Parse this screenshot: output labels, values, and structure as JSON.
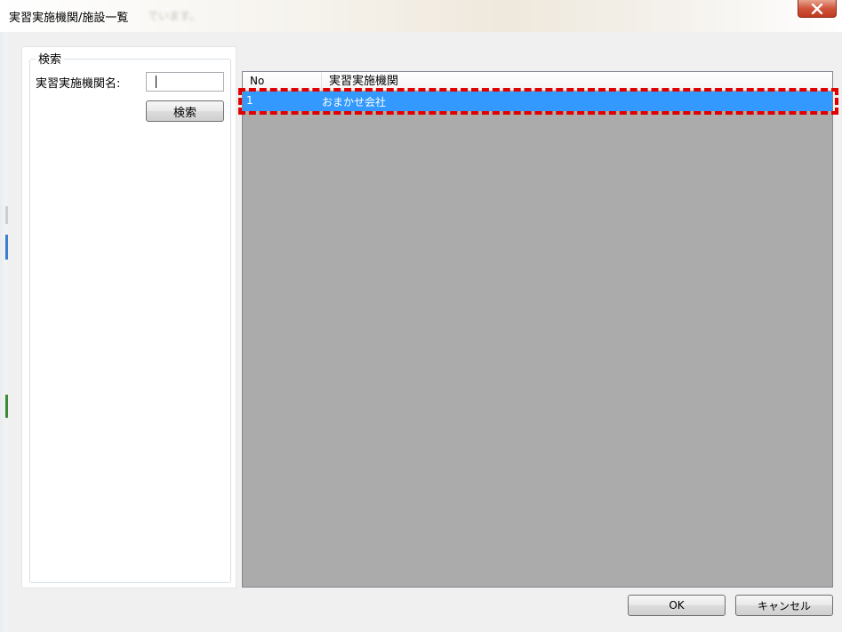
{
  "window": {
    "title": "実習実施機関/施設一覧",
    "title_blurred": "でいます。"
  },
  "search": {
    "group_title": "検索",
    "field_label": "実習実施機関名:",
    "input_value": "",
    "button_label": "検索"
  },
  "list": {
    "columns": [
      "No",
      "実習実施機関"
    ],
    "rows": [
      {
        "no": "1",
        "name": "おまかせ会社",
        "selected": true
      }
    ]
  },
  "footer": {
    "ok_label": "OK",
    "cancel_label": "キャンセル"
  },
  "colors": {
    "selection": "#3399ff",
    "list_background": "#ababab",
    "highlight_annotation": "#e10000",
    "window_background": "#f0f0f0"
  }
}
